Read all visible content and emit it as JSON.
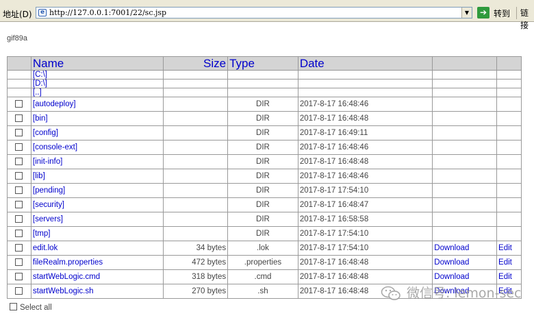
{
  "browser": {
    "address_label": "地址(D)",
    "url": "http://127.0.0.1:7001/22/sc.jsp",
    "go_label": "转到",
    "links_label": "链接"
  },
  "page": {
    "gif_text": "gif89a",
    "headers": {
      "name": "Name",
      "size": "Size",
      "type": "Type",
      "date": "Date"
    },
    "drives": [
      "[C:\\]",
      "[D:\\]",
      "[..]"
    ],
    "rows": [
      {
        "name": "[autodeploy]",
        "size": "",
        "type": "DIR",
        "date": "2017-8-17 16:48:46"
      },
      {
        "name": "[bin]",
        "size": "",
        "type": "DIR",
        "date": "2017-8-17 16:48:48"
      },
      {
        "name": "[config]",
        "size": "",
        "type": "DIR",
        "date": "2017-8-17 16:49:11"
      },
      {
        "name": "[console-ext]",
        "size": "",
        "type": "DIR",
        "date": "2017-8-17 16:48:46"
      },
      {
        "name": "[init-info]",
        "size": "",
        "type": "DIR",
        "date": "2017-8-17 16:48:48"
      },
      {
        "name": "[lib]",
        "size": "",
        "type": "DIR",
        "date": "2017-8-17 16:48:46"
      },
      {
        "name": "[pending]",
        "size": "",
        "type": "DIR",
        "date": "2017-8-17 17:54:10"
      },
      {
        "name": "[security]",
        "size": "",
        "type": "DIR",
        "date": "2017-8-17 16:48:47"
      },
      {
        "name": "[servers]",
        "size": "",
        "type": "DIR",
        "date": "2017-8-17 16:58:58"
      },
      {
        "name": "[tmp]",
        "size": "",
        "type": "DIR",
        "date": "2017-8-17 17:54:10"
      },
      {
        "name": "edit.lok",
        "size": "34 bytes",
        "type": ".lok",
        "date": "2017-8-17 17:54:10",
        "download": "Download",
        "edit": "Edit"
      },
      {
        "name": "fileRealm.properties",
        "size": "472 bytes",
        "type": ".properties",
        "date": "2017-8-17 16:48:48",
        "download": "Download",
        "edit": "Edit"
      },
      {
        "name": "startWebLogic.cmd",
        "size": "318 bytes",
        "type": ".cmd",
        "date": "2017-8-17 16:48:48",
        "download": "Download",
        "edit": "Edit"
      },
      {
        "name": "startWebLogic.sh",
        "size": "270 bytes",
        "type": ".sh",
        "date": "2017-8-17 16:48:48",
        "download": "Download",
        "edit": "Edit"
      }
    ],
    "select_all": "Select all"
  },
  "watermark": {
    "text": "微信号: lemon-sec",
    "icon": "wechat-icon"
  }
}
